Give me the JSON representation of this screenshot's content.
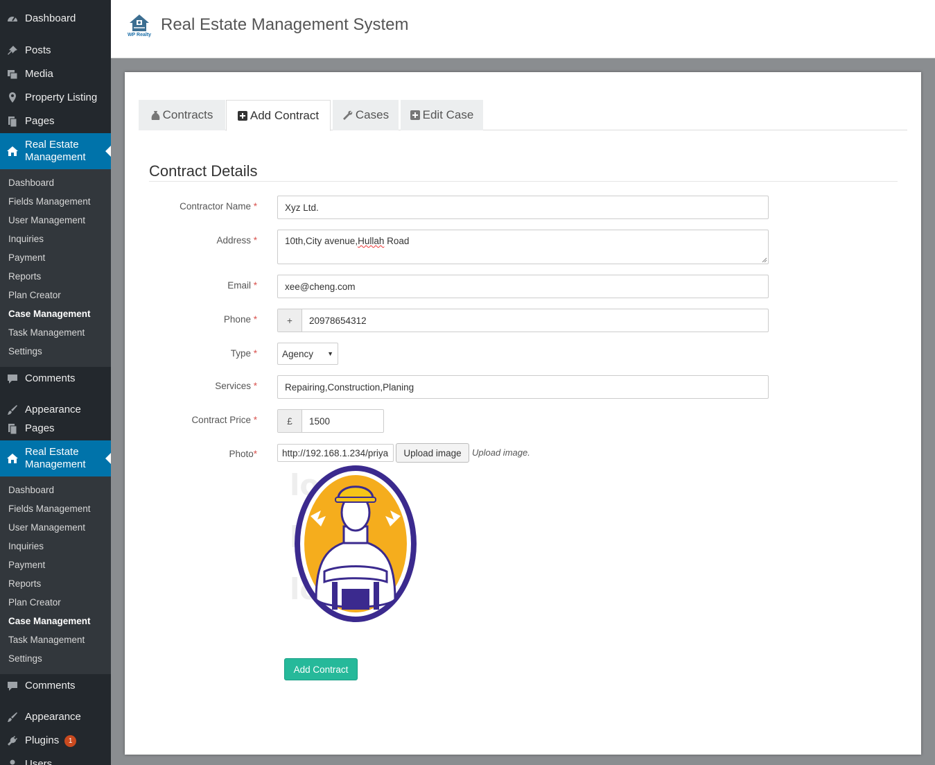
{
  "sidebar": {
    "dashboard": "Dashboard",
    "posts": "Posts",
    "media": "Media",
    "property_listing": "Property Listing",
    "pages": "Pages",
    "rem": "Real Estate Management",
    "submenu": [
      "Dashboard",
      "Fields Management",
      "User Management",
      "Inquiries",
      "Payment",
      "Reports",
      "Plan Creator",
      "Case Management",
      "Task Management",
      "Settings"
    ],
    "comments": "Comments",
    "appearance": "Appearance",
    "pages2": "Pages",
    "rem2": "Real Estate Management",
    "submenu2": [
      "Dashboard",
      "Fields Management",
      "User Management",
      "Inquiries",
      "Payment",
      "Reports",
      "Plan Creator",
      "Case Management",
      "Task Management",
      "Settings"
    ],
    "comments2": "Comments",
    "appearance2": "Appearance",
    "plugins": "Plugins",
    "plugins_badge": "1",
    "users": "Users"
  },
  "header": {
    "logo_text": "WP Realty",
    "title": "Real Estate Management System"
  },
  "tabs": [
    {
      "label": "Contracts",
      "icon": "money-bag-icon"
    },
    {
      "label": "Add Contract",
      "icon": "plus-square-icon"
    },
    {
      "label": "Cases",
      "icon": "wrench-icon"
    },
    {
      "label": "Edit Case",
      "icon": "plus-square-icon"
    }
  ],
  "form": {
    "section_title": "Contract Details",
    "contractor_name": {
      "label": "Contractor Name",
      "value": "Xyz Ltd."
    },
    "address": {
      "label": "Address",
      "value_pre": "10th,City avenue,",
      "value_misspelled": "Hullah",
      "value_post": " Road"
    },
    "email": {
      "label": "Email",
      "value": "xee@cheng.com"
    },
    "phone": {
      "label": "Phone",
      "prefix": "+",
      "value": "20978654312"
    },
    "type": {
      "label": "Type",
      "value": "Agency"
    },
    "services": {
      "label": "Services",
      "value": "Repairing,Construction,Planing"
    },
    "price": {
      "label": "Contract Price",
      "prefix": "£",
      "value": "1500"
    },
    "photo": {
      "label": "Photo",
      "url": "http://192.168.1.234/priya",
      "upload_label": "Upload image",
      "hint": "Upload image."
    },
    "required_mark": "*",
    "submit_label": "Add Contract"
  },
  "colors": {
    "sidebar": "#23282d",
    "active": "#0073aa",
    "submit": "#26b99a",
    "required": "#d9534f"
  }
}
